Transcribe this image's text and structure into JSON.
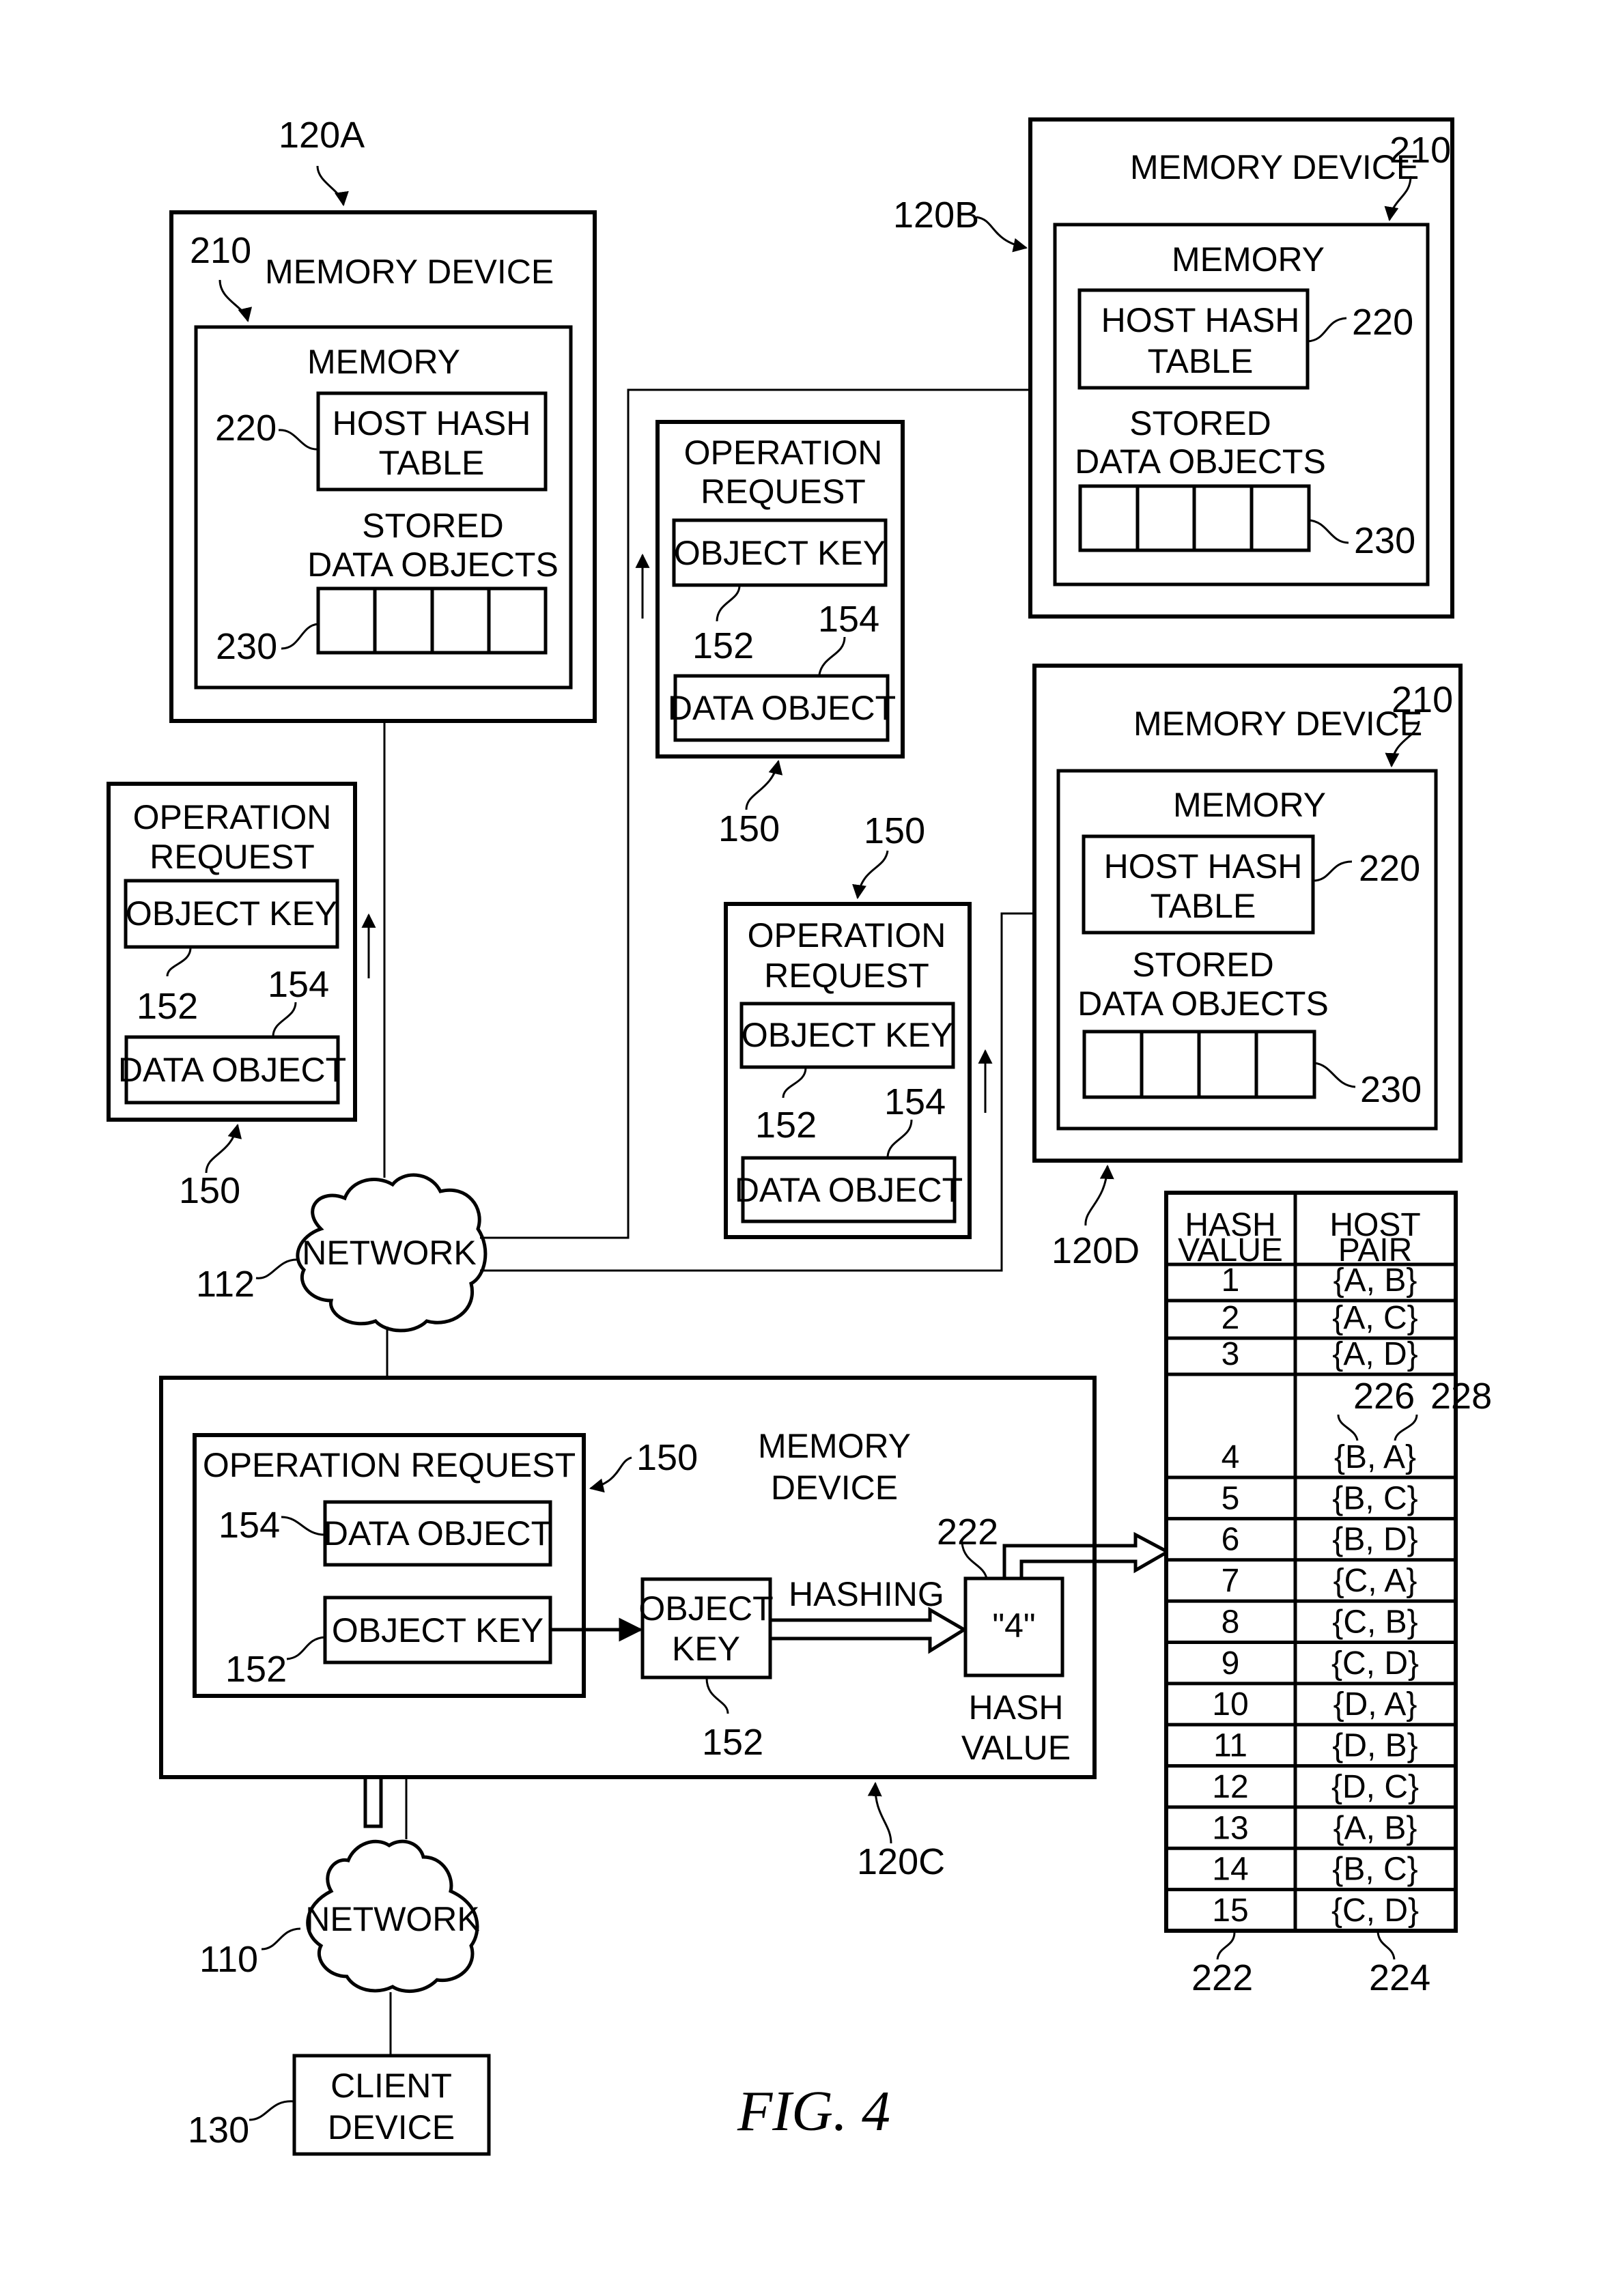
{
  "figure": {
    "caption": "FIG. 4",
    "colors": {
      "ink": "#000000",
      "paper": "#ffffff"
    }
  },
  "device_120A": {
    "ref": "120A",
    "title": "MEMORY DEVICE",
    "memory_ref": "210",
    "memory_title": "MEMORY",
    "host_hash_table": [
      "HOST HASH",
      "TABLE"
    ],
    "host_hash_ref": "220",
    "stored_title": [
      "STORED",
      "DATA OBJECTS"
    ],
    "stored_ref": "230",
    "slots": 4
  },
  "device_120B": {
    "ref": "120B",
    "title": "MEMORY DEVICE",
    "memory_ref": "210",
    "memory_title": "MEMORY",
    "host_hash_table": [
      "HOST HASH",
      "TABLE"
    ],
    "host_hash_ref": "220",
    "stored_title": [
      "STORED",
      "DATA OBJECTS"
    ],
    "stored_ref": "230",
    "slots": 4
  },
  "device_120D": {
    "ref": "120D",
    "title": "MEMORY DEVICE",
    "memory_ref": "210",
    "memory_title": "MEMORY",
    "host_hash_table": [
      "HOST HASH",
      "TABLE"
    ],
    "host_hash_ref": "220",
    "stored_title": [
      "STORED",
      "DATA OBJECTS"
    ],
    "stored_ref": "230",
    "slots": 4
  },
  "op_request_left": {
    "ref": "150",
    "title": [
      "OPERATION",
      "REQUEST"
    ],
    "object_key": "OBJECT KEY",
    "object_key_ref": "152",
    "data_object": "DATA OBJECT",
    "data_object_ref": "154"
  },
  "op_request_top": {
    "ref": "150",
    "title": [
      "OPERATION",
      "REQUEST"
    ],
    "object_key": "OBJECT KEY",
    "object_key_ref": "152",
    "data_object": "DATA OBJECT",
    "data_object_ref": "154"
  },
  "op_request_mid": {
    "ref": "150",
    "title": [
      "OPERATION",
      "REQUEST"
    ],
    "object_key": "OBJECT KEY",
    "object_key_ref": "152",
    "data_object": "DATA OBJECT",
    "data_object_ref": "154"
  },
  "device_120C": {
    "ref": "120C",
    "title": [
      "MEMORY",
      "DEVICE"
    ],
    "op_request_title": "OPERATION REQUEST",
    "op_request_ref": "150",
    "data_object": "DATA OBJECT",
    "data_object_ref": "154",
    "object_key": "OBJECT KEY",
    "object_key_ref": "152",
    "extracted_key": [
      "OBJECT",
      "KEY"
    ],
    "extracted_key_ref": "152",
    "hashing_label": "HASHING",
    "hash_value": "\"4\"",
    "hash_value_ref": "222",
    "hash_value_caption": [
      "HASH",
      "VALUE"
    ]
  },
  "network_112": {
    "ref": "112",
    "label": "NETWORK"
  },
  "network_110": {
    "ref": "110",
    "label": "NETWORK"
  },
  "client_device": {
    "ref": "130",
    "label": [
      "CLIENT",
      "DEVICE"
    ]
  },
  "hash_table": {
    "headers": [
      [
        "HASH",
        "VALUE"
      ],
      [
        "HOST",
        "PAIR"
      ]
    ],
    "column_refs": [
      "222",
      "224"
    ],
    "pair_refs": [
      "226",
      "228"
    ],
    "rows": [
      {
        "hash": "1",
        "pair": "{A, B}"
      },
      {
        "hash": "2",
        "pair": "{A, C}"
      },
      {
        "hash": "3",
        "pair": "{A, D}"
      },
      {
        "hash": "4",
        "pair": "{B, A}"
      },
      {
        "hash": "5",
        "pair": "{B, C}"
      },
      {
        "hash": "6",
        "pair": "{B, D}"
      },
      {
        "hash": "7",
        "pair": "{C, A}"
      },
      {
        "hash": "8",
        "pair": "{C, B}"
      },
      {
        "hash": "9",
        "pair": "{C, D}"
      },
      {
        "hash": "10",
        "pair": "{D, A}"
      },
      {
        "hash": "11",
        "pair": "{D, B}"
      },
      {
        "hash": "12",
        "pair": "{D, C}"
      },
      {
        "hash": "13",
        "pair": "{A, B}"
      },
      {
        "hash": "14",
        "pair": "{B, C}"
      },
      {
        "hash": "15",
        "pair": "{C, D}"
      }
    ]
  }
}
